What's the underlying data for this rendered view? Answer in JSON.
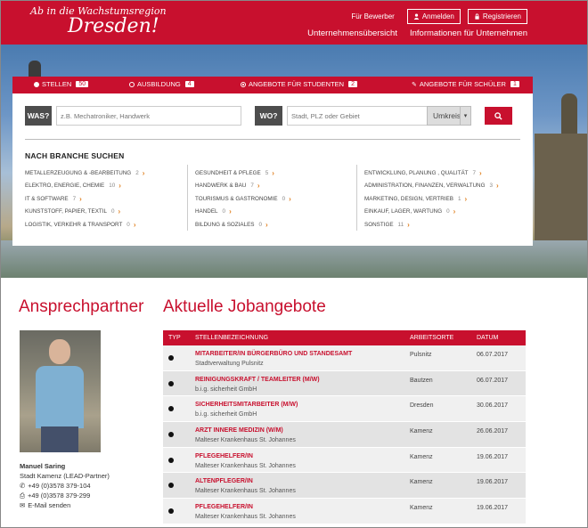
{
  "header": {
    "logo_line1": "Ab in die Wachstumsregion",
    "logo_line2": "Dresden!",
    "link_bewerber": "Für Bewerber",
    "btn_anmelden": "Anmelden",
    "btn_registrieren": "Registrieren",
    "nav": [
      "Unternehmensübersicht",
      "Informationen für Unternehmen"
    ]
  },
  "tabs": [
    {
      "label": "STELLEN",
      "count": "50"
    },
    {
      "label": "AUSBILDUNG",
      "count": "4"
    },
    {
      "label": "ANGEBOTE FÜR STUDENTEN",
      "count": "2"
    },
    {
      "label": "ANGEBOTE FÜR SCHÜLER",
      "count": "1"
    }
  ],
  "search": {
    "was_label": "WAS?",
    "was_placeholder": "z.B. Mechatroniker, Handwerk",
    "wo_label": "WO?",
    "wo_placeholder": "Stadt, PLZ oder Gebiet",
    "umkreis": "Umkreis"
  },
  "branche": {
    "heading": "NACH BRANCHE SUCHEN",
    "col1": [
      {
        "label": "METALLERZEUGUNG & -BEARBEITUNG",
        "count": "2"
      },
      {
        "label": "ELEKTRO, ENERGIE, CHEMIE",
        "count": "10"
      },
      {
        "label": "IT & SOFTWARE",
        "count": "7"
      },
      {
        "label": "KUNSTSTOFF, PAPIER, TEXTIL",
        "count": "0"
      },
      {
        "label": "LOGISTIK, VERKEHR & TRANSPORT",
        "count": "0"
      }
    ],
    "col2": [
      {
        "label": "GESUNDHEIT & PFLEGE",
        "count": "5"
      },
      {
        "label": "HANDWERK & BAU",
        "count": "7"
      },
      {
        "label": "TOURISMUS & GASTRONOMIE",
        "count": "0"
      },
      {
        "label": "HANDEL",
        "count": "0"
      },
      {
        "label": "BILDUNG & SOZIALES",
        "count": "0"
      }
    ],
    "col3": [
      {
        "label": "ENTWICKLUNG, PLANUNG , QUALITÄT",
        "count": "7"
      },
      {
        "label": "ADMINISTRATION, FINANZEN, VERWALTUNG",
        "count": "3"
      },
      {
        "label": "MARKETING, DESIGN, VERTRIEB",
        "count": "1"
      },
      {
        "label": "EINKAUF, LAGER, WARTUNG",
        "count": "0"
      },
      {
        "label": "SONSTIGE",
        "count": "11"
      }
    ]
  },
  "contact": {
    "heading": "Ansprechpartner",
    "name": "Manuel Saring",
    "org": "Stadt Kamenz (LEAD-Partner)",
    "phone": "+49 (0)3578 379-104",
    "fax": "+49 (0)3578 379-299",
    "email": "E-Mail senden"
  },
  "jobs": {
    "heading": "Aktuelle Jobangebote",
    "columns": [
      "TYP",
      "STELLENBEZEICHNUNG",
      "ARBEITSORTE",
      "DATUM"
    ],
    "rows": [
      {
        "title": "MITARBEITER/IN BÜRGERBÜRO UND STANDESAMT",
        "company": "Stadtverwaltung Pulsnitz",
        "ort": "Pulsnitz",
        "date": "06.07.2017"
      },
      {
        "title": "REINIGUNGSKRAFT / TEAMLEITER (M/W)",
        "company": "b.i.g. sicherheit GmbH",
        "ort": "Bautzen",
        "date": "06.07.2017"
      },
      {
        "title": "SICHERHEITSMITARBEITER (M/W)",
        "company": "b.i.g. sicherheit GmbH",
        "ort": "Dresden",
        "date": "30.06.2017"
      },
      {
        "title": "ARZT INNERE MEDIZIN (W/M)",
        "company": "Malteser Krankenhaus St. Johannes",
        "ort": "Kamenz",
        "date": "26.06.2017"
      },
      {
        "title": "PFLEGEHELFER/IN",
        "company": "Malteser Krankenhaus St. Johannes",
        "ort": "Kamenz",
        "date": "19.06.2017"
      },
      {
        "title": "ALTENPFLEGER/IN",
        "company": "Malteser Krankenhaus St. Johannes",
        "ort": "Kamenz",
        "date": "19.06.2017"
      },
      {
        "title": "PFLEGEHELFER/IN",
        "company": "Malteser Krankenhaus St. Johannes",
        "ort": "Kamenz",
        "date": "19.06.2017"
      }
    ]
  },
  "colors": {
    "brand": "#c8102e",
    "accent_arrow": "#e08020"
  }
}
